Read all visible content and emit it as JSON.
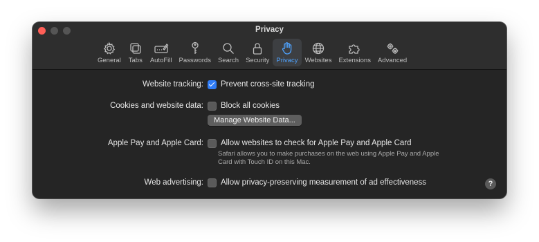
{
  "window": {
    "title": "Privacy"
  },
  "tabs": [
    {
      "label": "General",
      "icon": "gear-icon"
    },
    {
      "label": "Tabs",
      "icon": "tabs-icon"
    },
    {
      "label": "AutoFill",
      "icon": "autofill-icon"
    },
    {
      "label": "Passwords",
      "icon": "key-icon"
    },
    {
      "label": "Search",
      "icon": "search-icon"
    },
    {
      "label": "Security",
      "icon": "lock-icon"
    },
    {
      "label": "Privacy",
      "icon": "hand-icon",
      "active": true
    },
    {
      "label": "Websites",
      "icon": "globe-icon"
    },
    {
      "label": "Extensions",
      "icon": "puzzle-icon"
    },
    {
      "label": "Advanced",
      "icon": "gears-icon"
    }
  ],
  "settings": {
    "tracking": {
      "label": "Website tracking:",
      "option": "Prevent cross-site tracking",
      "checked": true
    },
    "cookies": {
      "label": "Cookies and website data:",
      "option": "Block all cookies",
      "checked": false,
      "button": "Manage Website Data..."
    },
    "applepay": {
      "label": "Apple Pay and Apple Card:",
      "option": "Allow websites to check for Apple Pay and Apple Card",
      "checked": false,
      "note": "Safari allows you to make purchases on the web using Apple Pay and Apple Card with Touch ID on this Mac."
    },
    "advertising": {
      "label": "Web advertising:",
      "option": "Allow privacy-preserving measurement of ad effectiveness",
      "checked": false
    }
  },
  "help": {
    "label": "?"
  },
  "colors": {
    "accent": "#4ea3ff",
    "checkbox_checked": "#2f7cf6",
    "close": "#ff5f57"
  }
}
